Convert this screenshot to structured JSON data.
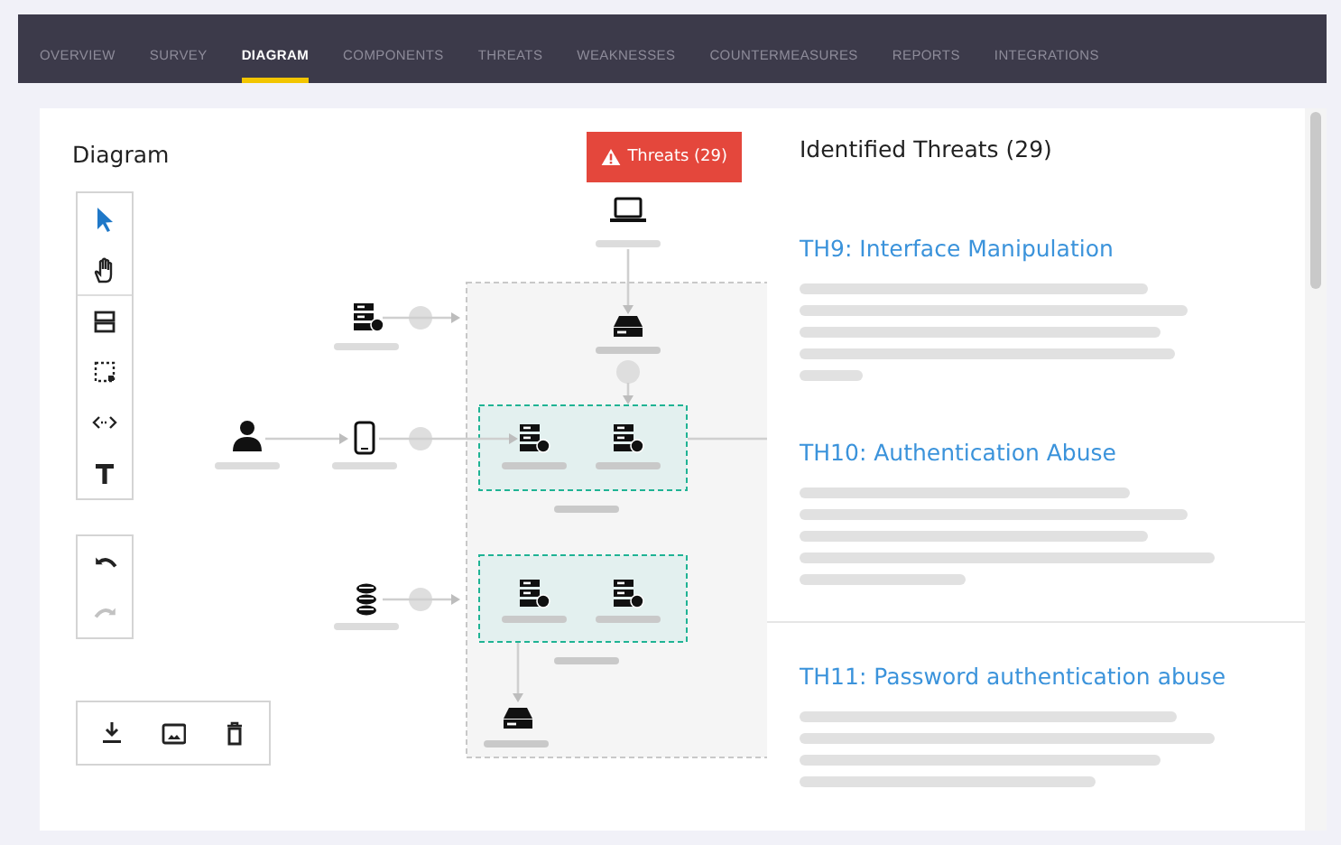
{
  "nav": {
    "tabs": [
      {
        "label": "OVERVIEW",
        "selected": false
      },
      {
        "label": "SURVEY",
        "selected": false
      },
      {
        "label": "DIAGRAM",
        "selected": true
      },
      {
        "label": "COMPONENTS",
        "selected": false
      },
      {
        "label": "THREATS",
        "selected": false
      },
      {
        "label": "WEAKNESSES",
        "selected": false
      },
      {
        "label": "COUNTERMEASURES",
        "selected": false
      },
      {
        "label": "REPORTS",
        "selected": false
      },
      {
        "label": "INTEGRATIONS",
        "selected": false
      }
    ]
  },
  "diagram": {
    "title": "Diagram",
    "threats_button": "Threats (29)",
    "tools": [
      {
        "kind": "pointer",
        "selected": true
      },
      {
        "kind": "hand",
        "selected": false
      },
      {
        "kind": "stack",
        "selected": false
      },
      {
        "kind": "area",
        "selected": false
      },
      {
        "kind": "connector",
        "selected": false
      },
      {
        "kind": "text",
        "selected": false
      }
    ],
    "history": [
      {
        "kind": "undo",
        "disabled": false
      },
      {
        "kind": "redo",
        "disabled": true
      }
    ],
    "actions": [
      {
        "kind": "download"
      },
      {
        "kind": "image"
      },
      {
        "kind": "delete"
      }
    ]
  },
  "threats": {
    "title": "Identified Threats (29)",
    "items": [
      {
        "title": "TH9: Interface Manipulation"
      },
      {
        "title": "TH10: Authentication Abuse"
      },
      {
        "title": "TH11: Password authentication abuse"
      }
    ]
  }
}
